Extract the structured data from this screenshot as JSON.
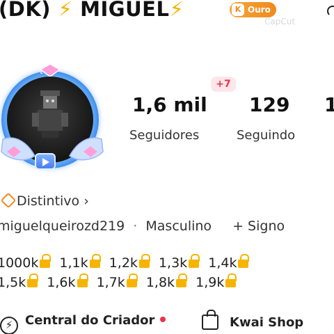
{
  "header": {
    "prefix": "(DK)",
    "bolt": "⚡",
    "name": "MIGUEL",
    "bolt_after": "⚡",
    "badge_label": "Ouro",
    "badge_icon": "kwai-icon",
    "watermark": "CapCut"
  },
  "profile": {
    "new_followers_badge": "+7",
    "stats": [
      {
        "value": "1,6 mil",
        "label": "Seguidores"
      },
      {
        "value": "129",
        "label": "Seguindo"
      },
      {
        "value": "1",
        "label": ""
      }
    ],
    "distintivo_label": "Distintivo",
    "distintivo_chevron": "›",
    "username": "miguelqueirozd219",
    "separator": "·",
    "gender": "Masculino",
    "sign_link": "+ Signo",
    "milestones_row1": [
      "1000k",
      "1,1k",
      "1,2k",
      "1,3k",
      "1,4k"
    ],
    "milestones_row2": [
      "1,5k",
      "1,6k",
      "1,7k",
      "1,8k",
      "1,9k"
    ]
  },
  "bottom": {
    "creator_central": "Central do Criador",
    "kwai_shop": "Kwai Shop"
  },
  "colors": {
    "accent_gold": "#f6b400",
    "badge_orange": "#f08a1c",
    "notification_red": "#e9344a",
    "ring_blue": "#2e7ce0"
  }
}
